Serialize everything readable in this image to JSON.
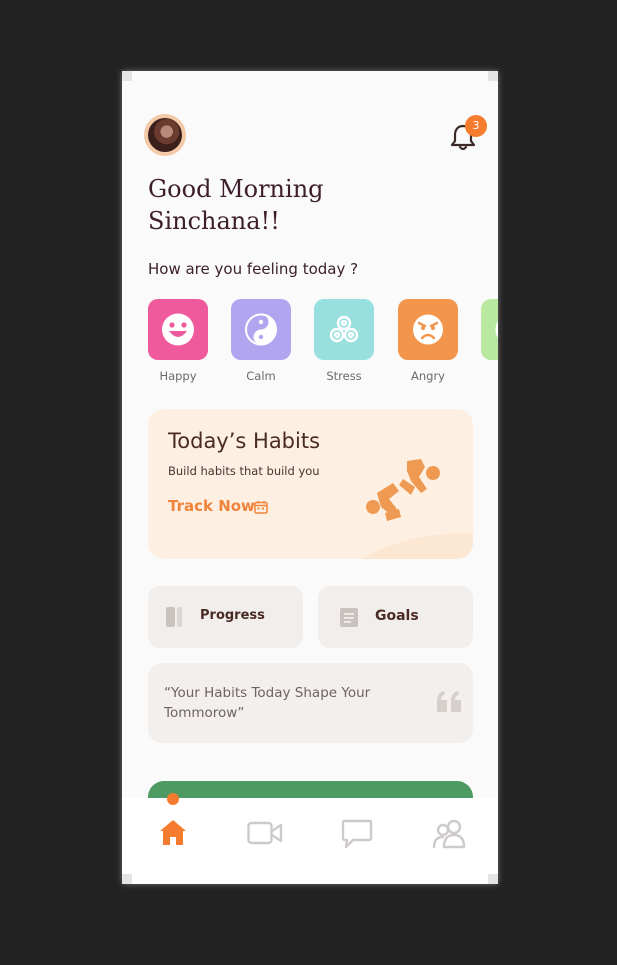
{
  "header": {
    "notification_count": "3"
  },
  "greeting": {
    "line1": "Good Morning",
    "line2": "Sinchana!!"
  },
  "mood_section": {
    "question": "How are you feeling today ?",
    "moods": [
      {
        "label": "Happy",
        "color": "#ee5a9c",
        "icon": "smiling-face-icon"
      },
      {
        "label": "Calm",
        "color": "#b1a5ef",
        "icon": "yin-yang-icon"
      },
      {
        "label": "Stress",
        "color": "#97e0df",
        "icon": "triskelion-icon"
      },
      {
        "label": "Angry",
        "color": "#f3954a",
        "icon": "angry-face-icon"
      },
      {
        "label": "",
        "color": "#b9e9a1",
        "icon": "mood-icon"
      }
    ]
  },
  "habits_card": {
    "title": "Today’s Habits",
    "subtitle": "Build habits that build you",
    "cta": "Track Now"
  },
  "tiles": {
    "progress": "Progress",
    "goals": "Goals"
  },
  "quote": {
    "text": "“Your Habits Today Shape Your Tommorow”"
  },
  "tab_bar": {
    "items": [
      "home-icon",
      "video-icon",
      "chat-icon",
      "community-icon"
    ],
    "active": "home-icon",
    "accent": "#f57c2f"
  }
}
